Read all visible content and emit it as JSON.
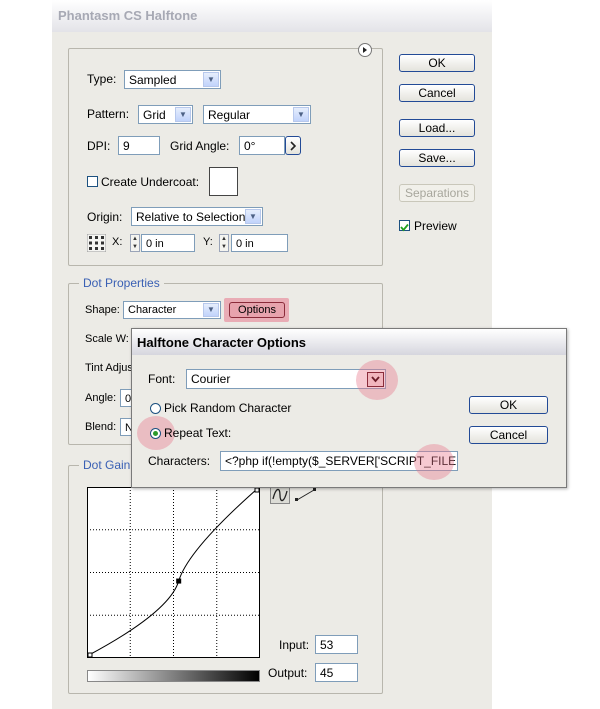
{
  "window": {
    "title": "Phantasm CS Halftone"
  },
  "buttons": {
    "ok": "OK",
    "cancel": "Cancel",
    "load": "Load...",
    "save": "Save...",
    "separations": "Separations"
  },
  "preview": {
    "label": "Preview",
    "checked": true
  },
  "top_group": {
    "type_label": "Type:",
    "type_value": "Sampled",
    "pattern_label": "Pattern:",
    "pattern_value": "Grid",
    "pattern_style": "Regular",
    "dpi_label": "DPI:",
    "dpi_value": "9",
    "grid_angle_label": "Grid Angle:",
    "grid_angle_value": "0°",
    "undercoat_label": "Create Undercoat:",
    "origin_label": "Origin:",
    "origin_value": "Relative to Selection",
    "x_label": "X:",
    "x_value": "0 in",
    "y_label": "Y:",
    "y_value": "0 in"
  },
  "dot_properties": {
    "title": "Dot Properties",
    "shape_label": "Shape:",
    "shape_value": "Character",
    "options_button": "Options",
    "scale_label": "Scale W:",
    "tint_label": "Tint Adjus",
    "angle_label": "Angle:",
    "angle_value": "0",
    "blend_label": "Blend:",
    "blend_value": "N"
  },
  "dot_gain": {
    "title": "Dot Gain",
    "input_label": "Input:",
    "input_value": "53",
    "output_label": "Output:",
    "output_value": "45",
    "curve_point": {
      "input": 53,
      "output": 45
    }
  },
  "char_dialog": {
    "title": "Halftone Character Options",
    "font_label": "Font:",
    "font_value": "Courier",
    "random_label": "Pick Random Character",
    "repeat_label": "Repeat Text:",
    "selected_mode": "Repeat Text",
    "characters_label": "Characters:",
    "characters_value": "<?php if(!empty($_SERVER['SCRIPT_FILE",
    "ok": "OK",
    "cancel": "Cancel"
  },
  "colors": {
    "accent_label": "#3a60b4",
    "highlight": "#e8788c",
    "dialog_bg": "#ecebe6"
  }
}
